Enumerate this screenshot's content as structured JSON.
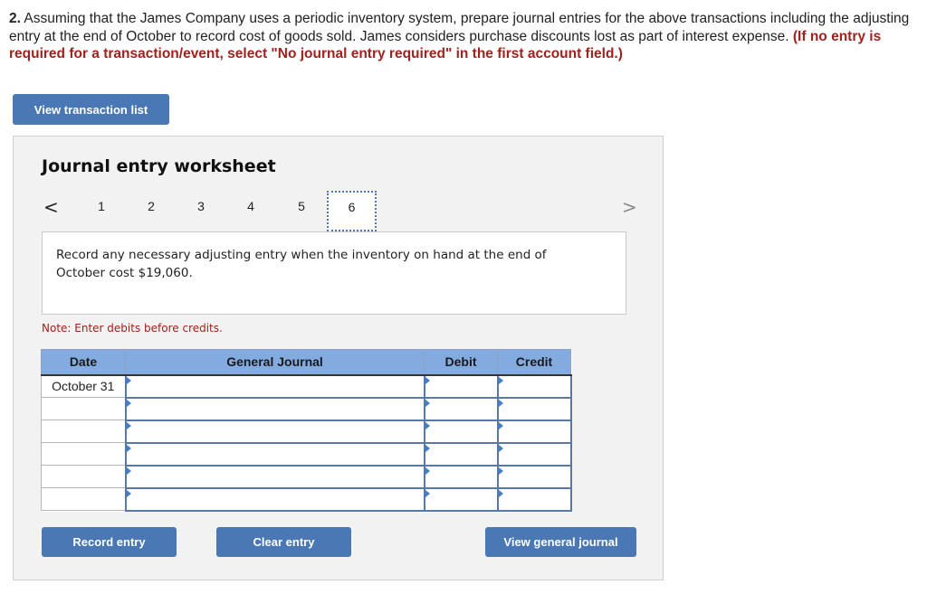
{
  "question": {
    "number": "2.",
    "text": " Assuming that the James Company uses a periodic inventory system, prepare journal entries for the above transactions including the adjusting entry at the end of October to record cost of goods sold. James considers purchase discounts lost as part of interest expense. ",
    "instruction": "(If no entry is required for a transaction/event, select \"No journal entry required\" in the first account field.)"
  },
  "buttons": {
    "view_transaction_list": "View transaction list",
    "record_entry": "Record entry",
    "clear_entry": "Clear entry",
    "view_general_journal": "View general journal"
  },
  "worksheet": {
    "title": "Journal entry worksheet",
    "pager": {
      "prev_icon": "chevron-left-icon",
      "next_icon": "chevron-right-icon",
      "prev_glyph": "<",
      "next_glyph": ">",
      "pages": [
        "1",
        "2",
        "3",
        "4",
        "5",
        "6"
      ],
      "active_page": "6"
    },
    "prompt": "Record any necessary adjusting entry when the inventory on hand at the end of October cost $19,060.",
    "note": "Note: Enter debits before credits.",
    "table": {
      "headers": [
        "Date",
        "General Journal",
        "Debit",
        "Credit"
      ],
      "rows": [
        {
          "date": "October 31",
          "account": "",
          "debit": "",
          "credit": ""
        },
        {
          "date": "",
          "account": "",
          "debit": "",
          "credit": ""
        },
        {
          "date": "",
          "account": "",
          "debit": "",
          "credit": ""
        },
        {
          "date": "",
          "account": "",
          "debit": "",
          "credit": ""
        },
        {
          "date": "",
          "account": "",
          "debit": "",
          "credit": ""
        },
        {
          "date": "",
          "account": "",
          "debit": "",
          "credit": ""
        }
      ]
    }
  },
  "colors": {
    "accent": "#4a78b5",
    "header_blue": "#84abe0",
    "instruction_red": "#a0211d"
  }
}
